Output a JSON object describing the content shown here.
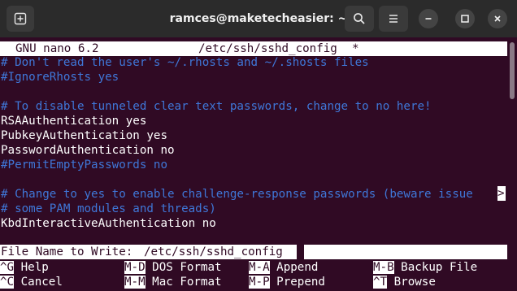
{
  "window": {
    "title": "ramces@maketecheasier: ~"
  },
  "icons": {
    "new_tab": "new-tab-icon",
    "search": "search-icon",
    "menu": "hamburger-menu-icon",
    "minimize": "minimize-icon",
    "maximize": "maximize-icon",
    "close": "close-icon"
  },
  "header": {
    "app": "GNU nano 6.2",
    "file": "/etc/ssh/sshd_config",
    "modified": "*"
  },
  "lines": [
    "# Don't read the user's ~/.rhosts and ~/.shosts files",
    "#IgnoreRhosts yes",
    "",
    "# To disable tunneled clear text passwords, change to no here!",
    "RSAAuthentication yes",
    "PubkeyAuthentication yes",
    "PasswordAuthentication no",
    "#PermitEmptyPasswords no",
    "",
    "# Change to yes to enable challenge-response passwords (beware issue",
    "# some PAM modules and threads)",
    "KbdInteractiveAuthentication no"
  ],
  "truncation_marker": ">",
  "prompt": {
    "label": "File Name to Write: ",
    "value": "/etc/ssh/sshd_config"
  },
  "shortcuts": {
    "row1": [
      {
        "key": "^G",
        "label": "Help"
      },
      {
        "key": "M-D",
        "label": "DOS Format"
      },
      {
        "key": "M-A",
        "label": "Append"
      },
      {
        "key": "M-B",
        "label": "Backup File"
      }
    ],
    "row2": [
      {
        "key": "^C",
        "label": "Cancel"
      },
      {
        "key": "M-M",
        "label": "Mac Format"
      },
      {
        "key": "M-P",
        "label": "Prepend"
      },
      {
        "key": "^T",
        "label": "Browse"
      }
    ]
  }
}
